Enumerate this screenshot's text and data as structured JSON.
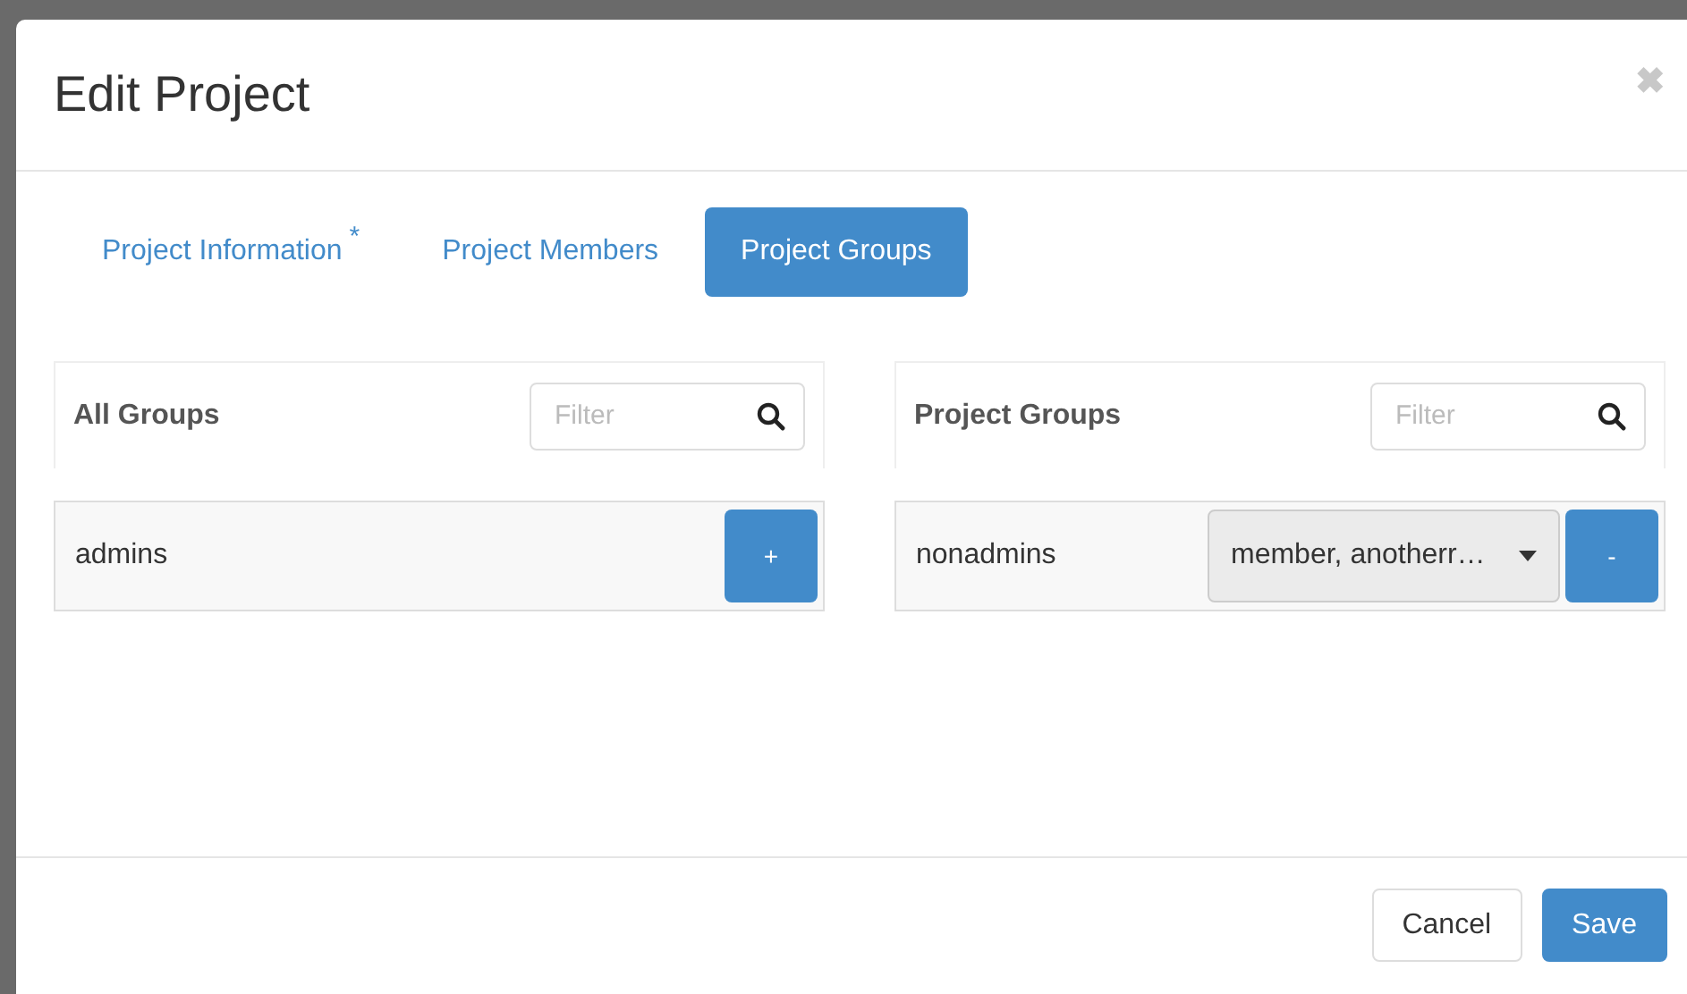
{
  "dialog": {
    "title": "Edit Project",
    "close": "✖"
  },
  "tabs": [
    {
      "label": "Project Information",
      "marker": "*",
      "selected": false
    },
    {
      "label": "Project Members",
      "selected": false
    },
    {
      "label": "Project Groups",
      "selected": true
    }
  ],
  "panels": [
    {
      "title": "All Groups",
      "filter_placeholder": "Filter",
      "rows": [
        {
          "name": "admins",
          "action": "+"
        }
      ]
    },
    {
      "title": "Project Groups",
      "filter_placeholder": "Filter",
      "rows": [
        {
          "name": "nonadmins",
          "roles": "member, anotherr…",
          "action": "-"
        }
      ]
    }
  ],
  "buttons": [
    {
      "label": "Cancel",
      "kind": "default"
    },
    {
      "label": "Save",
      "kind": "primary"
    }
  ]
}
